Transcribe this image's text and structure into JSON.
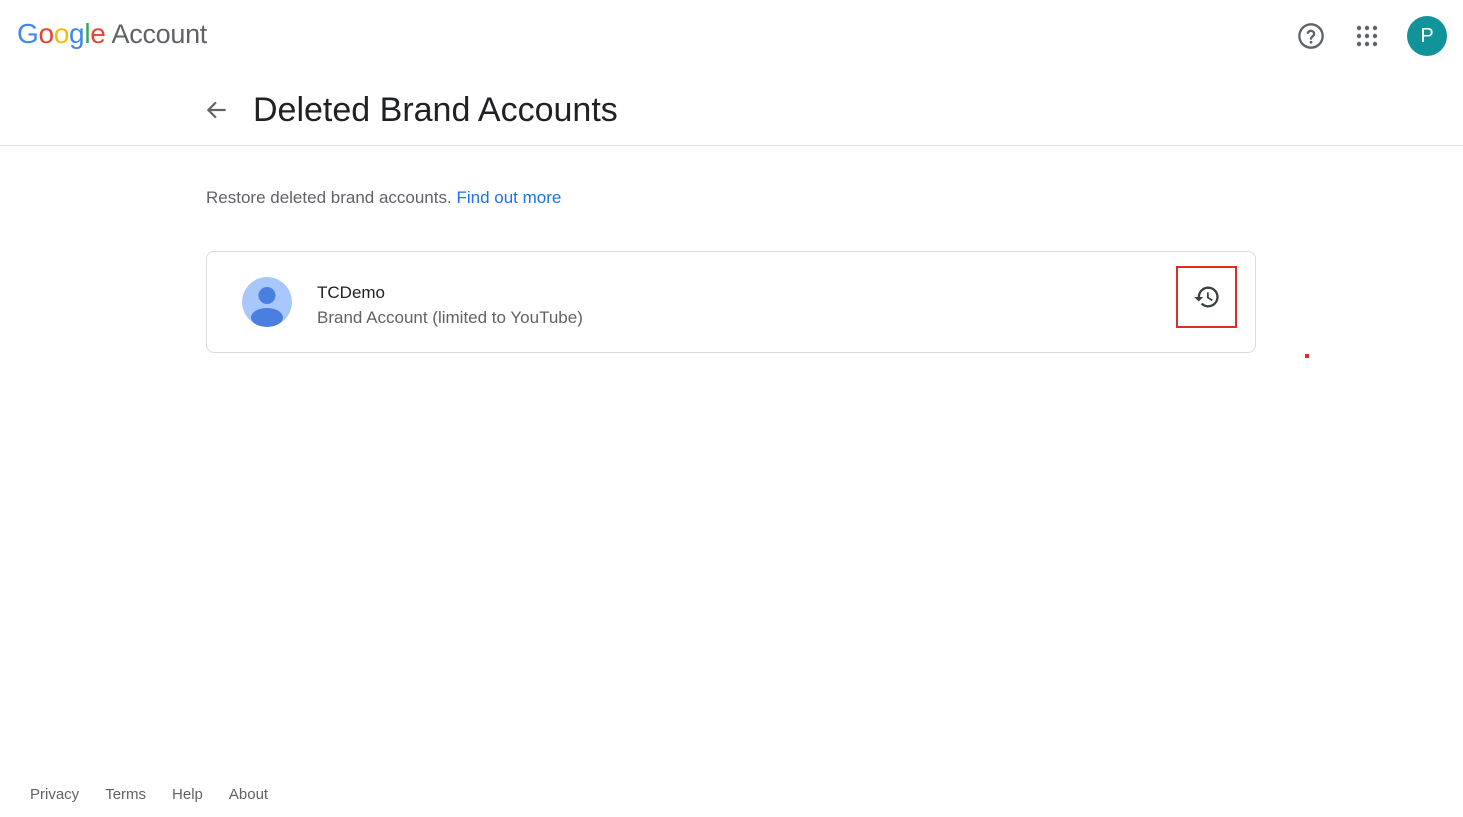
{
  "header": {
    "logo_letters": [
      {
        "char": "G",
        "color": "#4285F4"
      },
      {
        "char": "o",
        "color": "#EA4335"
      },
      {
        "char": "o",
        "color": "#FBBC05"
      },
      {
        "char": "g",
        "color": "#4285F4"
      },
      {
        "char": "l",
        "color": "#34A853"
      },
      {
        "char": "e",
        "color": "#EA4335"
      }
    ],
    "product_name": "Account",
    "help_icon": "help-circle-icon",
    "apps_icon": "apps-grid-icon",
    "avatar_initial": "P",
    "avatar_color": "#12939A"
  },
  "title_bar": {
    "back_icon": "arrow-back-icon",
    "title": "Deleted Brand Accounts"
  },
  "intro": {
    "text": "Restore deleted brand accounts.",
    "link_text": "Find out more"
  },
  "accounts": [
    {
      "name": "TCDemo",
      "type": "Brand Account (limited to YouTube)",
      "avatar_icon": "person-avatar-icon",
      "action_icon": "restore-history-icon"
    }
  ],
  "footer": {
    "links": [
      "Privacy",
      "Terms",
      "Help",
      "About"
    ]
  },
  "colors": {
    "link": "#1a73e8",
    "highlight": "#d93025",
    "avatar_bg": "#A8C7FA",
    "avatar_fg": "#4A7FE0"
  }
}
